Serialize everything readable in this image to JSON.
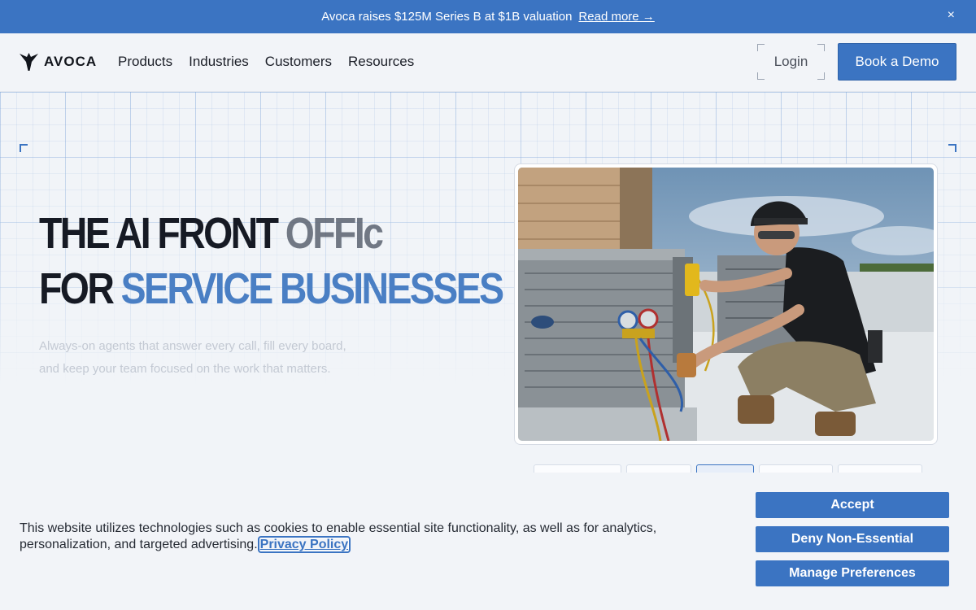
{
  "announcement": {
    "message": "Avoca raises $125M Series B at $1B valuation",
    "link_label": "Read more →",
    "close_glyph": "×"
  },
  "nav": {
    "logo_text": "AVOCA",
    "logo_icon": "avoca-bird-icon",
    "menu": [
      "Products",
      "Industries",
      "Customers",
      "Resources"
    ],
    "login_label": "Login",
    "demo_label": "Book a Demo"
  },
  "hero": {
    "line1_prefix": "THE AI FRONT ",
    "line1_typing": "OFFIc",
    "line2_prefix": "FOR ",
    "line2_highlight": "SERVICE BUSINESSES",
    "subtitle": "Always-on agents that answer every call, fill every board, and keep your team focused on the work that matters.",
    "photo_icon": "hvac-technician-photo",
    "active_tab_index": 2
  },
  "cookie": {
    "text": "This website utilizes technologies such as cookies to enable essential site functionality, as well as for analytics, personalization, and targeted advertising.",
    "policy_label": "Privacy Policy",
    "accept_label": "Accept",
    "deny_label": "Deny Non-Essential",
    "manage_label": "Manage Preferences"
  },
  "colors": {
    "brand": "#3b74c2",
    "headline_blue": "#4a7fc4",
    "background": "#f1f4f8"
  }
}
